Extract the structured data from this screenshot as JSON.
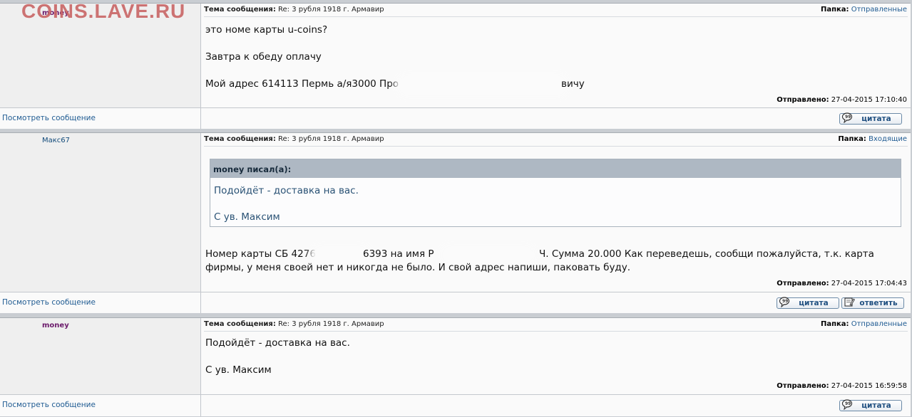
{
  "watermark": "COINS.LAVE.RU",
  "labels": {
    "subject": "Тема сообщения:",
    "folder": "Папка:",
    "sent": "Отправлено:",
    "view_message": "Посмотреть сообщение",
    "quote_button": "цитата",
    "reply_button": "ответить"
  },
  "posts": [
    {
      "author": "money",
      "subject": "Re: 3 рубля 1918 г. Армавир",
      "folder": "Отправленные",
      "lines": [
        "это номе карты u-coins?",
        "Завтра к обеду оплачу",
        "Мой адрес 614113 Пермь а/я3000 Про",
        "вичу"
      ],
      "sent": "27-04-2015 17:10:40"
    },
    {
      "author": "Макс67",
      "subject": "Re: 3 рубля 1918 г. Армавир",
      "folder": "Входящие",
      "quote": {
        "author": "money писал(а):",
        "lines": [
          "Подойдёт - доставка на вас.",
          "С ув. Максим"
        ]
      },
      "lines": [
        "Номер карты СБ 4276",
        "6393 на имя Р",
        "Ч. Сумма 20.000 Как переведешь, сообщи пожалуйста, т.к. карта",
        "фирмы, у меня своей нет и никогда не было. И свой адрес напиши, паковать буду."
      ],
      "sent": "27-04-2015 17:04:43"
    },
    {
      "author": "money",
      "subject": "Re: 3 рубля 1918 г. Армавир",
      "folder": "Отправленные",
      "lines": [
        "Подойдёт - доставка на вас.",
        "С ув. Максим"
      ],
      "sent": "27-04-2015 16:59:58"
    }
  ]
}
